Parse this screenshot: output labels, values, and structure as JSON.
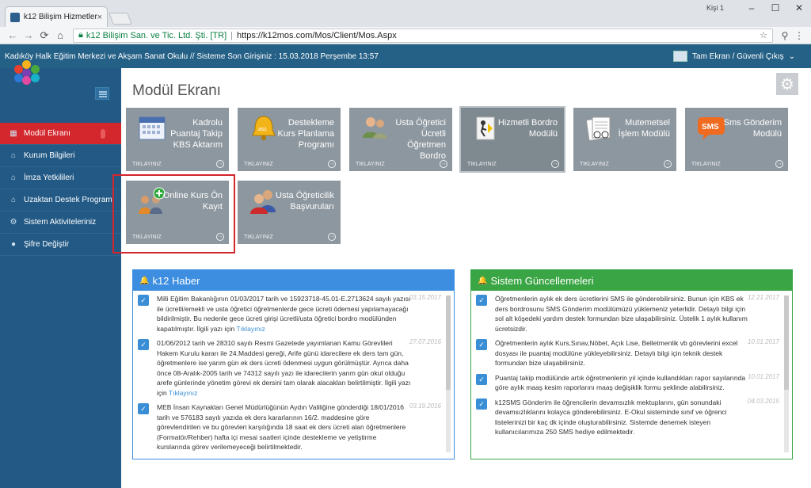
{
  "browser": {
    "tab_title": "k12 Bilişim Hizmetleri",
    "tab_close": "×",
    "window_user": "Kişi 1",
    "window_controls": [
      "–",
      "☐",
      "✕"
    ],
    "cert": "k12 Bilişim San. ve Tic. Ltd. Şti. [TR]",
    "separator": "|",
    "url": "https://k12mos.com/Mos/Client/Mos.Aspx",
    "nav": [
      "←",
      "→",
      "⟳",
      "⌂"
    ]
  },
  "topbar": {
    "info": "Kadıköy Halk Eğitim Merkezi ve Akşam Sanat Okulu // Sisteme Son Girişiniz : 15.03.2018 Perşembe 13:57",
    "right_label": "Tam Ekran / Güvenli Çıkış",
    "chevron": "⌄"
  },
  "sidebar": {
    "items": [
      {
        "label": "Modül Ekranı",
        "icon": "grid-icon",
        "glyph": "▦"
      },
      {
        "label": "Kurum Bilgileri",
        "icon": "home-icon",
        "glyph": "⌂"
      },
      {
        "label": "İmza Yetkilileri",
        "icon": "home-icon",
        "glyph": "⌂"
      },
      {
        "label": "Uzaktan Destek Programı",
        "icon": "home-icon",
        "glyph": "⌂"
      },
      {
        "label": "Sistem Aktiviteleriniz",
        "icon": "cogs-icon",
        "glyph": "⚙"
      },
      {
        "label": "Şifre Değiştir",
        "icon": "user-icon",
        "glyph": "●"
      }
    ]
  },
  "main": {
    "title": "Modül Ekranı",
    "gear": "⚙",
    "tile_footer": "TIKLAYINIZ",
    "tile_arrow": "→",
    "tiles": [
      {
        "title": "Kadrolu Puantaj Takip KBS Aktarım",
        "icon": "calendar-icon"
      },
      {
        "title": "Destekleme Kurs Planlama Programı",
        "icon": "bell-icon"
      },
      {
        "title": "Usta Öğretici Ücretli Öğretmen Bordro",
        "icon": "people-icon"
      },
      {
        "title": "Hizmetli Bordro Modülü",
        "icon": "door-exit-icon"
      },
      {
        "title": "Mutemetsel İşlem Modülü",
        "icon": "documents-icon"
      },
      {
        "title": "Sms Gönderim Modülü",
        "icon": "sms-icon"
      },
      {
        "title": "Online Kurs Ön Kayıt",
        "icon": "add-users-icon"
      },
      {
        "title": "Usta Öğreticilik Başvuruları",
        "icon": "users-icon"
      }
    ]
  },
  "news": {
    "title": "k12 Haber",
    "bell": "🔔",
    "check": "✓",
    "items": [
      {
        "text": "Milli Eğitim Bakanlığının 01/03/2017 tarih ve 15923718-45.01-E.2713624 sayılı yazısı ile ücretli/emekli ve usta öğretici öğretmenlerde gece ücreti ödemesi yapılamayacağı bildirilmiştir. Bu nedenle gece ücreti girişi ücretli/usta öğretici bordro modülünden kapatılmıştır. İlgili yazı için",
        "link": "Tıklayınız",
        "date": "03.15.2017"
      },
      {
        "text": "01/06/2012 tarih ve 28310 sayılı Resmi Gazetede yayımlanan Kamu Görevlileri Hakem Kurulu kararı ile 24.Maddesi gereği, Arife günü idarecilere ek ders tam gün, öğretmenlere ise yarım gün ek ders ücreti ödenmesi uygun görülmüştür. Ayrıca daha önce 08-Aralık-2005 tarih ve 74312 sayılı yazı ile idarecilerin yarım gün okul olduğu arefe günlerinde yönetim görevi ek dersini tam olarak alacakları belirtilmiştir. İlgili yazı için",
        "link": "Tıklayınız",
        "date": "27.07.2016"
      },
      {
        "text": "MEB İnsan Kaynakları Genel Müdürlüğünün Aydın Valiliğine gönderdiği 18/01/2016 tarih ve 576183 sayılı yazıda ek ders kararlarının 16/2. maddesine göre görevlendirilen ve bu görevleri karşılığında 18 saat ek ders ücreti alan öğretmenlere (Formatör/Rehber) hafta içi mesai saatleri içinde destekleme ve yetiştirme kurslarında görev verilemeyeceği belirtilmektedir.",
        "link": "",
        "date": "03.19.2016"
      }
    ]
  },
  "updates": {
    "title": "Sistem Güncellemeleri",
    "bell": "🔔",
    "check": "✓",
    "items": [
      {
        "text": "Öğretmenlerin aylık ek ders ücretlerini SMS ile gönderebilirsiniz. Bunun için KBS ek ders bordrosunu SMS Gönderim modülümüzü yüklemeniz yeterlidir. Detaylı bilgi için sol alt köşedeki yardım destek formundan bize ulaşabilirsiniz. Üstelik 1 aylık kullanım ücretsizdir.",
        "date": "12.21.2017"
      },
      {
        "text": "Öğretmenlerin aylık Kurs,Sınav,Nöbet, Açık Lise, Belletmenlik vb görevlerini excel dosyası ile puantaj modülüne yükleyebilirsiniz. Detaylı bilgi için teknik destek formundan bize ulaşabilirsiniz.",
        "date": "10.01.2017"
      },
      {
        "text": "Puantaj takip modülünde artık öğretmenlerin yıl içinde kullandıkları rapor sayılarında göre aylık maaş kesim raporlarını maaş değişiklik formu şeklinde alabilirsiniz.",
        "date": "10.01.2017"
      },
      {
        "text": "k12SMS Gönderim ile öğrencilerin devamsızlık mektuplarını, gün sonundaki devamsızlıklarını kolayca gönderebilirsiniz. E-Okul sisteminde sınıf ve öğrenci listelerinizi bir kaç dk içinde oluşturabilirsiniz. Sistemde denemek isteyen kullanıcılarımıza 250 SMS hediye edilmektedir.",
        "date": "04.03.2015"
      }
    ]
  }
}
